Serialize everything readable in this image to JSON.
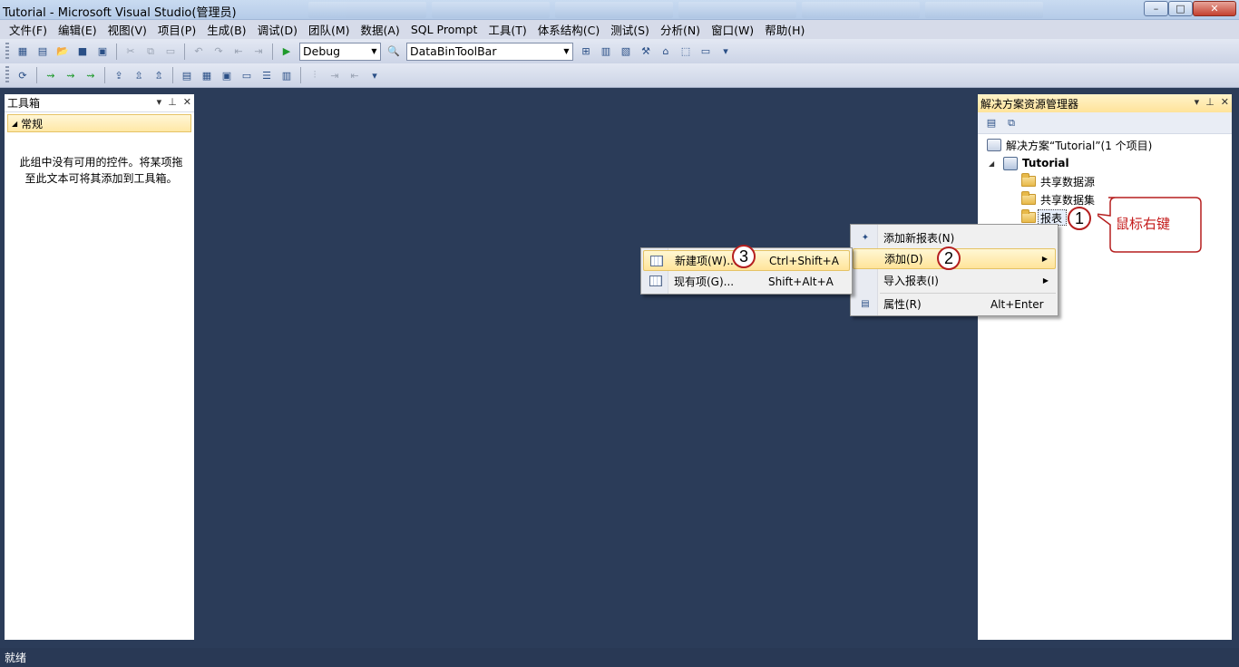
{
  "window": {
    "title": "Tutorial - Microsoft Visual Studio(管理员)",
    "min_glyph": "–",
    "max_glyph": "□",
    "close_glyph": "✕"
  },
  "menubar": {
    "items": [
      "文件(F)",
      "编辑(E)",
      "视图(V)",
      "项目(P)",
      "生成(B)",
      "调试(D)",
      "团队(M)",
      "数据(A)",
      "SQL Prompt",
      "工具(T)",
      "体系结构(C)",
      "测试(S)",
      "分析(N)",
      "窗口(W)",
      "帮助(H)"
    ]
  },
  "toolbar": {
    "configuration": "Debug",
    "startup_item": "DataBinToolBar"
  },
  "toolbox": {
    "title": "工具箱",
    "group": "常规",
    "empty_message": "此组中没有可用的控件。将某项拖至此文本可将其添加到工具箱。"
  },
  "solution_explorer": {
    "title": "解决方案资源管理器",
    "solution": "解决方案“Tutorial”(1 个项目)",
    "project": "Tutorial",
    "folders": [
      "共享数据源",
      "共享数据集",
      "报表"
    ]
  },
  "context_menu": {
    "items": [
      {
        "label": "添加新报表(N)",
        "shortcut": ""
      },
      {
        "label": "添加(D)",
        "shortcut": ""
      },
      {
        "label": "导入报表(I)",
        "shortcut": ""
      },
      {
        "label": "属性(R)",
        "shortcut": "Alt+Enter"
      }
    ]
  },
  "submenu": {
    "items": [
      {
        "label": "新建项(W)...",
        "shortcut": "Ctrl+Shift+A"
      },
      {
        "label": "现有项(G)...",
        "shortcut": "Shift+Alt+A"
      }
    ]
  },
  "annotations": {
    "step1": "1",
    "step2": "2",
    "step3": "3",
    "callout": "鼠标右键",
    "callout_color": "#c41a1a"
  },
  "statusbar": {
    "text": "就绪"
  }
}
